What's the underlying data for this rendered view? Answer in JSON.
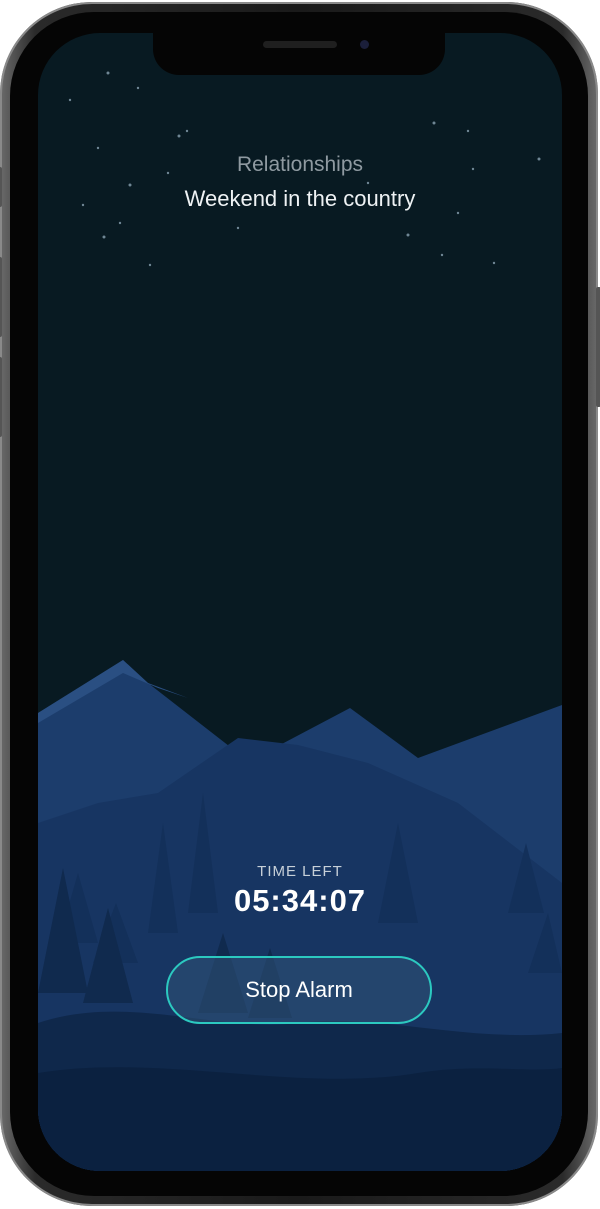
{
  "alarm": {
    "category": "Relationships",
    "title": "Weekend in the country"
  },
  "countdown": {
    "label": "TIME LEFT",
    "value": "05:34:07"
  },
  "actions": {
    "stop_label": "Stop Alarm"
  },
  "colors": {
    "sky": "#081a22",
    "mountain_back": "#1c3a6a",
    "mountain_front": "#183464",
    "ground": "#0f2647",
    "button_border": "#2cc9c0"
  }
}
